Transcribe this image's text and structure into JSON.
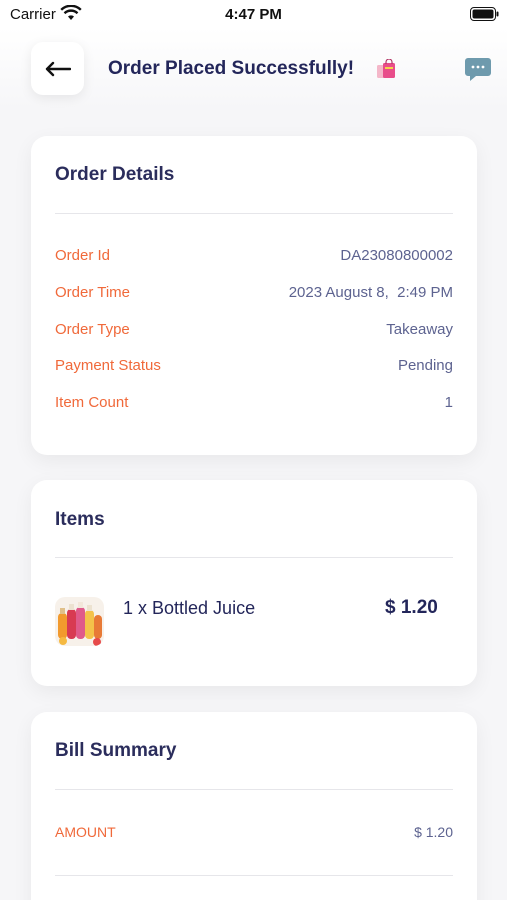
{
  "status_bar": {
    "carrier": "Carrier",
    "time": "4:47 PM"
  },
  "header": {
    "title": "Order Placed Successfully!",
    "back_icon": "arrow-left-icon",
    "bag_icon": "shopping-bags-icon",
    "chat_icon": "chat-bubble-icon"
  },
  "order_details": {
    "title": "Order Details",
    "rows": [
      {
        "label": "Order Id",
        "value": "DA23080800002"
      },
      {
        "label": "Order Time",
        "value": "2023 August 8,  2:49 PM"
      },
      {
        "label": "Order Type",
        "value": "Takeaway"
      },
      {
        "label": "Payment Status",
        "value": "Pending"
      },
      {
        "label": "Item Count",
        "value": "1"
      }
    ]
  },
  "items": {
    "title": "Items",
    "list": [
      {
        "name": "1 x Bottled Juice",
        "price": "$ 1.20"
      }
    ]
  },
  "bill_summary": {
    "title": "Bill Summary",
    "rows": [
      {
        "label": "AMOUNT",
        "value": "$ 1.20"
      }
    ]
  },
  "colors": {
    "accent": "#f0693a",
    "title": "#23265a",
    "value": "#5d6390",
    "background": "#f6f6f8"
  }
}
